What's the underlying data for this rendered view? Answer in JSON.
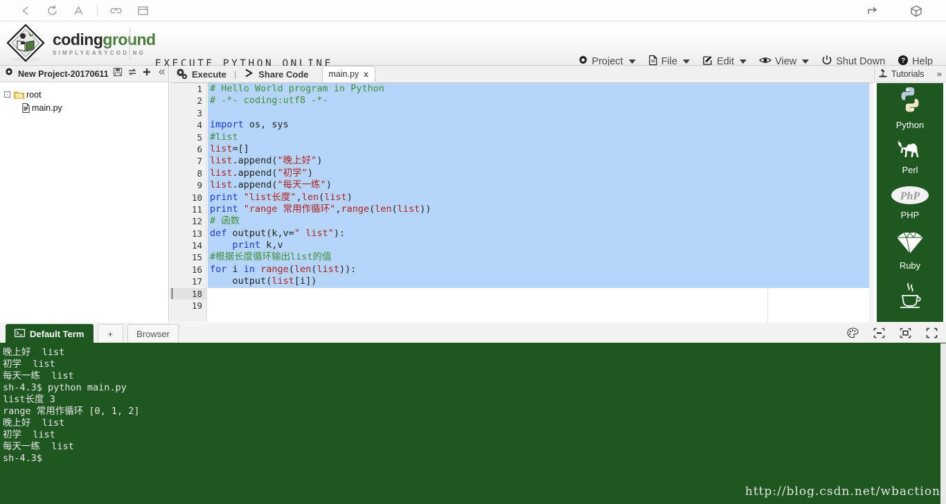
{
  "browser": {
    "left_icons": [
      "back-arrow-icon",
      "reload-icon",
      "font-size-icon",
      "divider",
      "link-icon",
      "window-icon"
    ],
    "right_icons": [
      "share-icon",
      "cube-icon"
    ]
  },
  "header": {
    "brand_first": "coding",
    "brand_second": "ground",
    "brand_sub": "SIMPLYEASYCODING",
    "tagline": "EXECUTE PYTHON ONLINE",
    "menu": [
      {
        "label": "Project",
        "icon": "gear-icon",
        "caret": true
      },
      {
        "label": "File",
        "icon": "file-icon",
        "caret": true
      },
      {
        "label": "Edit",
        "icon": "edit-pencil-icon",
        "caret": true
      },
      {
        "label": "View",
        "icon": "eye-icon",
        "caret": true
      },
      {
        "label": "Shut Down",
        "icon": "power-icon",
        "caret": false
      },
      {
        "label": "Help",
        "icon": "help-circle-icon",
        "caret": false
      }
    ]
  },
  "project": {
    "title": "New Project-20170611",
    "header_icon": "gear-icon",
    "tools": [
      "save-icon",
      "refresh-icon",
      "add-icon",
      "collapse-icon"
    ],
    "tree": [
      {
        "label": "root",
        "type": "folder",
        "expander": "-"
      },
      {
        "label": "main.py",
        "type": "file"
      }
    ]
  },
  "editor": {
    "execute_label": "Execute",
    "separator": "|",
    "share_label": "Share Code",
    "tab_label": "main.py",
    "tab_close": "x",
    "total_lines": 19,
    "selected_from": 1,
    "selected_to": 17,
    "cursor_line": 18,
    "fold_lines": [
      13,
      16
    ],
    "lines": [
      {
        "n": 1,
        "tokens": [
          {
            "t": "# Hello World program in Python",
            "c": "tok-comment"
          }
        ]
      },
      {
        "n": 2,
        "tokens": [
          {
            "t": "# -*- coding:utf8 -*-",
            "c": "tok-comment"
          }
        ]
      },
      {
        "n": 3,
        "tokens": []
      },
      {
        "n": 4,
        "tokens": [
          {
            "t": "import",
            "c": "tok-kw"
          },
          {
            "t": " os, sys",
            "c": "tok-plain"
          }
        ]
      },
      {
        "n": 5,
        "tokens": [
          {
            "t": "#list",
            "c": "tok-comment"
          }
        ]
      },
      {
        "n": 6,
        "tokens": [
          {
            "t": "list",
            "c": "tok-var"
          },
          {
            "t": "=[]",
            "c": "tok-plain"
          }
        ]
      },
      {
        "n": 7,
        "tokens": [
          {
            "t": "list",
            "c": "tok-var"
          },
          {
            "t": ".append(",
            "c": "tok-plain"
          },
          {
            "t": "\"晚上好\"",
            "c": "tok-str"
          },
          {
            "t": ")",
            "c": "tok-plain"
          }
        ]
      },
      {
        "n": 8,
        "tokens": [
          {
            "t": "list",
            "c": "tok-var"
          },
          {
            "t": ".append(",
            "c": "tok-plain"
          },
          {
            "t": "\"初学\"",
            "c": "tok-str"
          },
          {
            "t": ")",
            "c": "tok-plain"
          }
        ]
      },
      {
        "n": 9,
        "tokens": [
          {
            "t": "list",
            "c": "tok-var"
          },
          {
            "t": ".append(",
            "c": "tok-plain"
          },
          {
            "t": "\"每天一练\"",
            "c": "tok-str"
          },
          {
            "t": ")",
            "c": "tok-plain"
          }
        ]
      },
      {
        "n": 10,
        "tokens": [
          {
            "t": "print",
            "c": "tok-kw"
          },
          {
            "t": " ",
            "c": "tok-plain"
          },
          {
            "t": "\"list长度\"",
            "c": "tok-str"
          },
          {
            "t": ",",
            "c": "tok-plain"
          },
          {
            "t": "len",
            "c": "tok-fn"
          },
          {
            "t": "(",
            "c": "tok-plain"
          },
          {
            "t": "list",
            "c": "tok-var"
          },
          {
            "t": ")",
            "c": "tok-plain"
          }
        ]
      },
      {
        "n": 11,
        "tokens": [
          {
            "t": "print",
            "c": "tok-kw"
          },
          {
            "t": " ",
            "c": "tok-plain"
          },
          {
            "t": "\"range 常用作循环\"",
            "c": "tok-str"
          },
          {
            "t": ",",
            "c": "tok-plain"
          },
          {
            "t": "range",
            "c": "tok-fn"
          },
          {
            "t": "(",
            "c": "tok-plain"
          },
          {
            "t": "len",
            "c": "tok-fn"
          },
          {
            "t": "(",
            "c": "tok-plain"
          },
          {
            "t": "list",
            "c": "tok-var"
          },
          {
            "t": "))",
            "c": "tok-plain"
          }
        ]
      },
      {
        "n": 12,
        "tokens": [
          {
            "t": "# 函数",
            "c": "tok-comment"
          }
        ]
      },
      {
        "n": 13,
        "tokens": [
          {
            "t": "def",
            "c": "tok-kw"
          },
          {
            "t": " output(k,v=",
            "c": "tok-plain"
          },
          {
            "t": "\" list\"",
            "c": "tok-str"
          },
          {
            "t": "):",
            "c": "tok-plain"
          }
        ]
      },
      {
        "n": 14,
        "tokens": [
          {
            "t": "    ",
            "c": "tok-plain"
          },
          {
            "t": "print",
            "c": "tok-kw"
          },
          {
            "t": " k,v",
            "c": "tok-plain"
          }
        ]
      },
      {
        "n": 15,
        "tokens": [
          {
            "t": "#根据长度循环输出list的值",
            "c": "tok-comment"
          }
        ]
      },
      {
        "n": 16,
        "tokens": [
          {
            "t": "for",
            "c": "tok-kw"
          },
          {
            "t": " i ",
            "c": "tok-plain"
          },
          {
            "t": "in",
            "c": "tok-kw"
          },
          {
            "t": " ",
            "c": "tok-plain"
          },
          {
            "t": "range",
            "c": "tok-fn"
          },
          {
            "t": "(",
            "c": "tok-plain"
          },
          {
            "t": "len",
            "c": "tok-fn"
          },
          {
            "t": "(",
            "c": "tok-plain"
          },
          {
            "t": "list",
            "c": "tok-var"
          },
          {
            "t": ")):",
            "c": "tok-plain"
          }
        ]
      },
      {
        "n": 17,
        "tokens": [
          {
            "t": "    output(",
            "c": "tok-plain"
          },
          {
            "t": "list",
            "c": "tok-var"
          },
          {
            "t": "[i])",
            "c": "tok-plain"
          }
        ]
      },
      {
        "n": 18,
        "tokens": []
      },
      {
        "n": 19,
        "tokens": []
      }
    ]
  },
  "tutorials": {
    "title": "Tutorials",
    "header_icon": "microscope-icon",
    "expand_icon": "»",
    "items": [
      {
        "label": "Python",
        "icon": "python-logo-icon"
      },
      {
        "label": "Perl",
        "icon": "camel-logo-icon"
      },
      {
        "label": "PHP",
        "icon": "php-logo-icon"
      },
      {
        "label": "Ruby",
        "icon": "ruby-gem-icon"
      },
      {
        "label": "",
        "icon": "java-coffee-icon"
      }
    ]
  },
  "terminal": {
    "tabs": [
      {
        "label": "Default Term",
        "active": true,
        "icon": "terminal-icon"
      },
      {
        "label": "+",
        "active": false
      },
      {
        "label": "Browser",
        "active": false
      }
    ],
    "tools": [
      "palette-icon",
      "minimize-icon",
      "restore-icon",
      "fullscreen-icon"
    ],
    "output": [
      "晚上好  list",
      "初学  list",
      "每天一练  list",
      "sh-4.3$ python main.py",
      "list长度 3",
      "range 常用作循环 [0, 1, 2]",
      "晚上好  list",
      "初学  list",
      "每天一练  list",
      "sh-4.3$"
    ]
  },
  "watermark": "http://blog.csdn.net/wbaction",
  "colors": {
    "brand_green": "#4a7d3a",
    "terminal_green": "#1f5720",
    "selection_blue": "#b6d5fb",
    "comment_green": "#3f8f3f",
    "keyword_blue": "#1b35d6",
    "string_red": "#b02020"
  }
}
